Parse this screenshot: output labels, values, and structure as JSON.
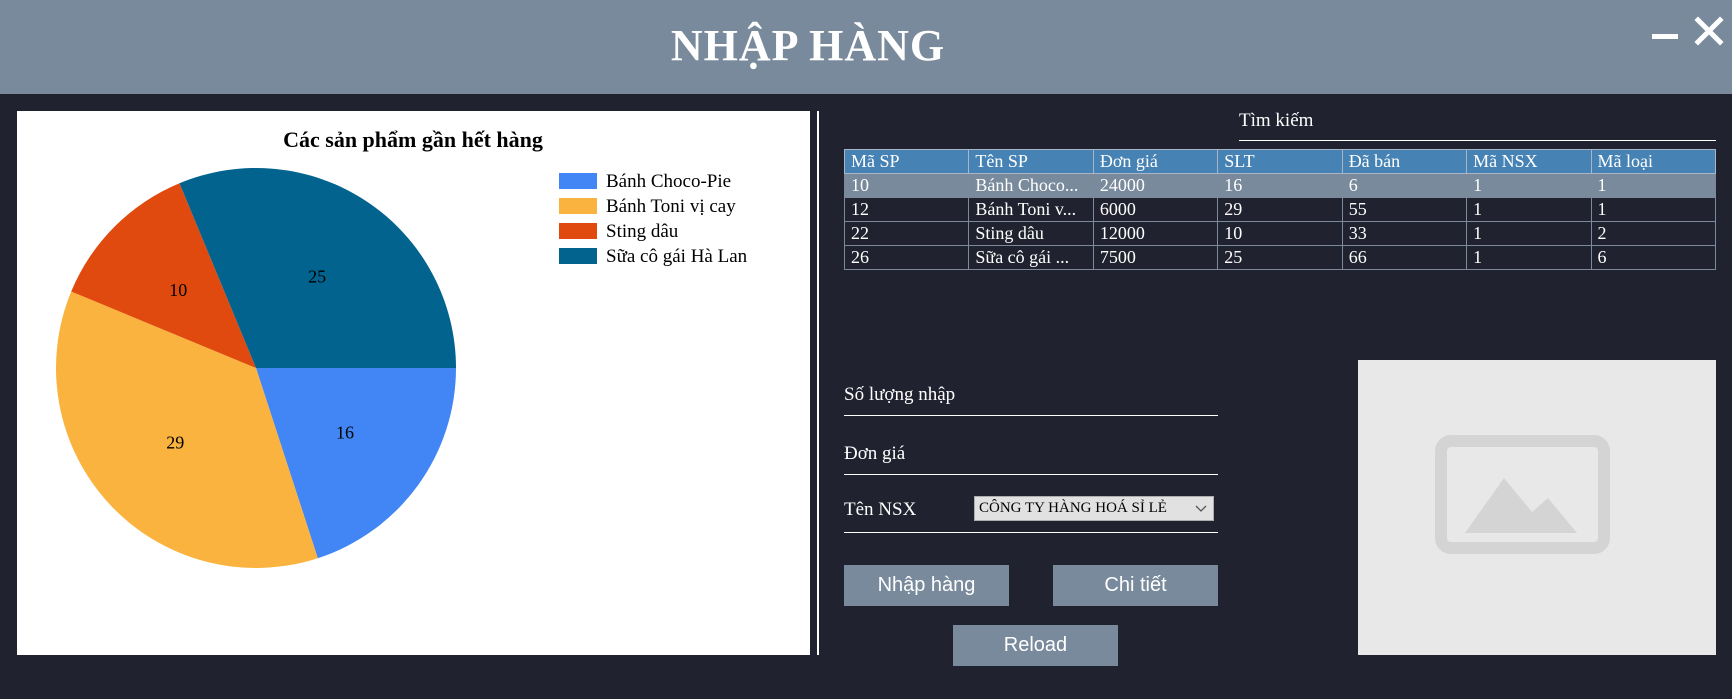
{
  "window": {
    "title": "NHẬP HÀNG"
  },
  "chart_data": {
    "type": "pie",
    "title": "Các sản phẩm gần hết hàng",
    "categories": [
      "Bánh Choco-Pie",
      "Bánh Toni vị cay",
      "Sting dâu",
      "Sữa cô gái Hà Lan"
    ],
    "values": [
      16,
      29,
      10,
      25
    ],
    "colors": [
      "#4285f4",
      "#fbb33f",
      "#e04a0e",
      "#03638f"
    ],
    "legend_position": "top-right"
  },
  "search": {
    "label": "Tìm kiếm"
  },
  "table": {
    "columns": [
      "Mã SP",
      "Tên SP",
      "Đơn giá",
      "SLT",
      "Đã bán",
      "Mã NSX",
      "Mã loại"
    ],
    "rows": [
      [
        "10",
        "Bánh Choco...",
        "24000",
        "16",
        "6",
        "1",
        "1"
      ],
      [
        "12",
        "Bánh Toni v...",
        "6000",
        "29",
        "55",
        "1",
        "1"
      ],
      [
        "22",
        "Sting dâu",
        "12000",
        "10",
        "33",
        "1",
        "2"
      ],
      [
        "26",
        "Sữa cô gái ...",
        "7500",
        "25",
        "66",
        "1",
        "6"
      ]
    ],
    "selected_row": 0
  },
  "form": {
    "qty_label": "Số lượng nhập",
    "qty_value": "",
    "price_label": "Đơn giá",
    "price_value": "",
    "supplier_label": "Tên NSX",
    "supplier_selected": "CÔNG TY HÀNG HOÁ SỈ LẺ"
  },
  "buttons": {
    "import": "Nhập hàng",
    "detail": "Chi tiết",
    "reload": "Reload"
  },
  "colors": {
    "background": "#20222f",
    "titlebar": "#788a9b",
    "button": "#788a9b",
    "table_header": "#4682b4",
    "selected_row": "#788a9b"
  }
}
